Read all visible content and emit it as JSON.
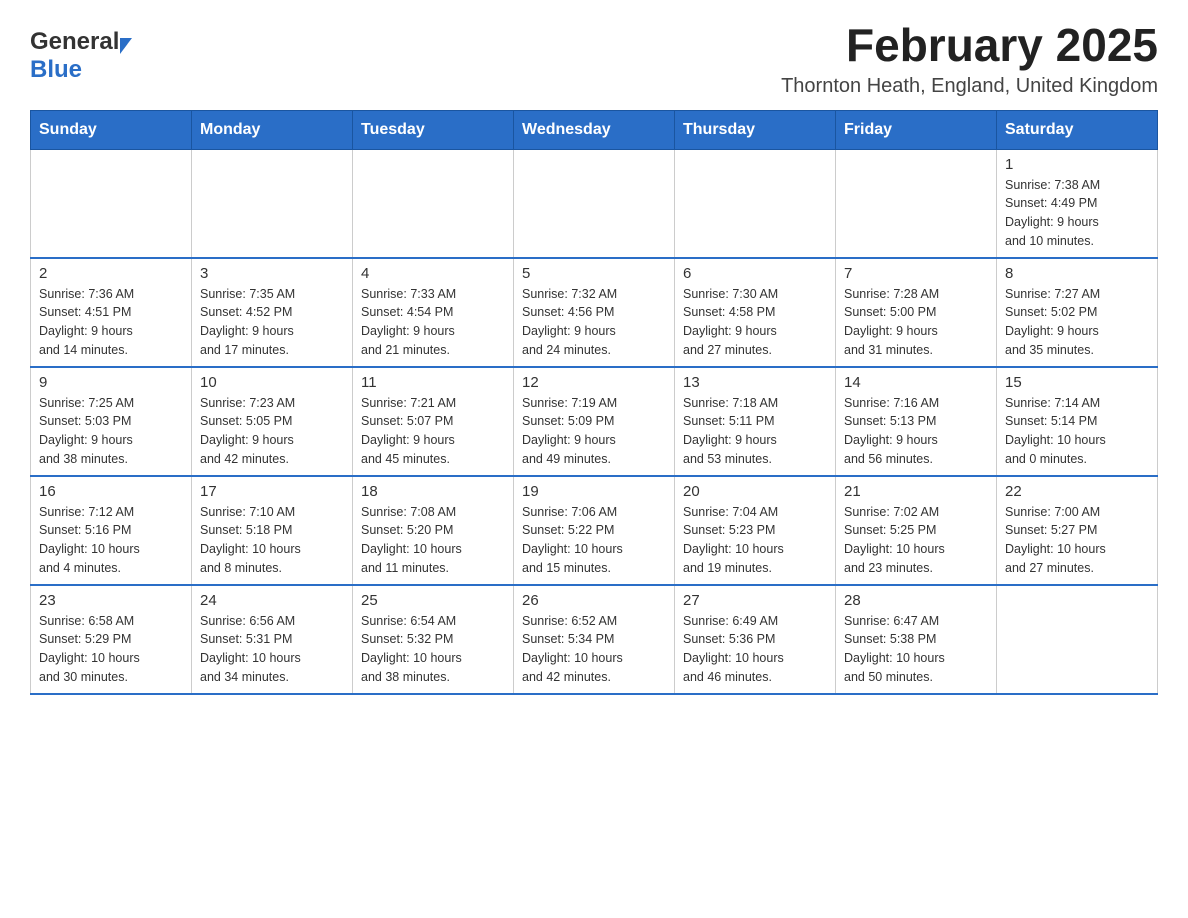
{
  "logo": {
    "general": "General",
    "blue": "Blue"
  },
  "title": "February 2025",
  "location": "Thornton Heath, England, United Kingdom",
  "days_of_week": [
    "Sunday",
    "Monday",
    "Tuesday",
    "Wednesday",
    "Thursday",
    "Friday",
    "Saturday"
  ],
  "weeks": [
    [
      {
        "day": "",
        "info": ""
      },
      {
        "day": "",
        "info": ""
      },
      {
        "day": "",
        "info": ""
      },
      {
        "day": "",
        "info": ""
      },
      {
        "day": "",
        "info": ""
      },
      {
        "day": "",
        "info": ""
      },
      {
        "day": "1",
        "info": "Sunrise: 7:38 AM\nSunset: 4:49 PM\nDaylight: 9 hours\nand 10 minutes."
      }
    ],
    [
      {
        "day": "2",
        "info": "Sunrise: 7:36 AM\nSunset: 4:51 PM\nDaylight: 9 hours\nand 14 minutes."
      },
      {
        "day": "3",
        "info": "Sunrise: 7:35 AM\nSunset: 4:52 PM\nDaylight: 9 hours\nand 17 minutes."
      },
      {
        "day": "4",
        "info": "Sunrise: 7:33 AM\nSunset: 4:54 PM\nDaylight: 9 hours\nand 21 minutes."
      },
      {
        "day": "5",
        "info": "Sunrise: 7:32 AM\nSunset: 4:56 PM\nDaylight: 9 hours\nand 24 minutes."
      },
      {
        "day": "6",
        "info": "Sunrise: 7:30 AM\nSunset: 4:58 PM\nDaylight: 9 hours\nand 27 minutes."
      },
      {
        "day": "7",
        "info": "Sunrise: 7:28 AM\nSunset: 5:00 PM\nDaylight: 9 hours\nand 31 minutes."
      },
      {
        "day": "8",
        "info": "Sunrise: 7:27 AM\nSunset: 5:02 PM\nDaylight: 9 hours\nand 35 minutes."
      }
    ],
    [
      {
        "day": "9",
        "info": "Sunrise: 7:25 AM\nSunset: 5:03 PM\nDaylight: 9 hours\nand 38 minutes."
      },
      {
        "day": "10",
        "info": "Sunrise: 7:23 AM\nSunset: 5:05 PM\nDaylight: 9 hours\nand 42 minutes."
      },
      {
        "day": "11",
        "info": "Sunrise: 7:21 AM\nSunset: 5:07 PM\nDaylight: 9 hours\nand 45 minutes."
      },
      {
        "day": "12",
        "info": "Sunrise: 7:19 AM\nSunset: 5:09 PM\nDaylight: 9 hours\nand 49 minutes."
      },
      {
        "day": "13",
        "info": "Sunrise: 7:18 AM\nSunset: 5:11 PM\nDaylight: 9 hours\nand 53 minutes."
      },
      {
        "day": "14",
        "info": "Sunrise: 7:16 AM\nSunset: 5:13 PM\nDaylight: 9 hours\nand 56 minutes."
      },
      {
        "day": "15",
        "info": "Sunrise: 7:14 AM\nSunset: 5:14 PM\nDaylight: 10 hours\nand 0 minutes."
      }
    ],
    [
      {
        "day": "16",
        "info": "Sunrise: 7:12 AM\nSunset: 5:16 PM\nDaylight: 10 hours\nand 4 minutes."
      },
      {
        "day": "17",
        "info": "Sunrise: 7:10 AM\nSunset: 5:18 PM\nDaylight: 10 hours\nand 8 minutes."
      },
      {
        "day": "18",
        "info": "Sunrise: 7:08 AM\nSunset: 5:20 PM\nDaylight: 10 hours\nand 11 minutes."
      },
      {
        "day": "19",
        "info": "Sunrise: 7:06 AM\nSunset: 5:22 PM\nDaylight: 10 hours\nand 15 minutes."
      },
      {
        "day": "20",
        "info": "Sunrise: 7:04 AM\nSunset: 5:23 PM\nDaylight: 10 hours\nand 19 minutes."
      },
      {
        "day": "21",
        "info": "Sunrise: 7:02 AM\nSunset: 5:25 PM\nDaylight: 10 hours\nand 23 minutes."
      },
      {
        "day": "22",
        "info": "Sunrise: 7:00 AM\nSunset: 5:27 PM\nDaylight: 10 hours\nand 27 minutes."
      }
    ],
    [
      {
        "day": "23",
        "info": "Sunrise: 6:58 AM\nSunset: 5:29 PM\nDaylight: 10 hours\nand 30 minutes."
      },
      {
        "day": "24",
        "info": "Sunrise: 6:56 AM\nSunset: 5:31 PM\nDaylight: 10 hours\nand 34 minutes."
      },
      {
        "day": "25",
        "info": "Sunrise: 6:54 AM\nSunset: 5:32 PM\nDaylight: 10 hours\nand 38 minutes."
      },
      {
        "day": "26",
        "info": "Sunrise: 6:52 AM\nSunset: 5:34 PM\nDaylight: 10 hours\nand 42 minutes."
      },
      {
        "day": "27",
        "info": "Sunrise: 6:49 AM\nSunset: 5:36 PM\nDaylight: 10 hours\nand 46 minutes."
      },
      {
        "day": "28",
        "info": "Sunrise: 6:47 AM\nSunset: 5:38 PM\nDaylight: 10 hours\nand 50 minutes."
      },
      {
        "day": "",
        "info": ""
      }
    ]
  ]
}
